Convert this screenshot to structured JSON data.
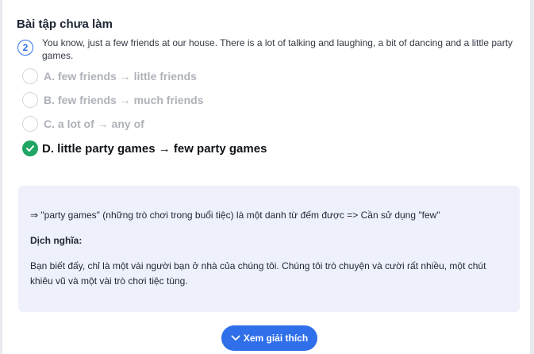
{
  "section": {
    "title": "Bài tập chưa làm"
  },
  "question": {
    "number": "2",
    "text": "You know, just a few friends at our house. There is a lot of talking and laughing, a bit of dancing and a little party games."
  },
  "options": [
    {
      "label": "A. few friends → little friends",
      "state": "unselected"
    },
    {
      "label": "B. few friends → much friends",
      "state": "unselected"
    },
    {
      "label": "C. a lot of → any of",
      "state": "unselected"
    },
    {
      "label": "D. little party games → few party games",
      "state": "correct"
    }
  ],
  "explanation": {
    "rule": "⇒ \"party games\" (những trò chơi trong buổi tiệc) là một danh từ đếm được => Cần sử dụng \"few\"",
    "translation_heading": "Dịch nghĩa:",
    "translation": "Bạn biết đấy, chỉ là một vài người bạn ở nhà của chúng tôi. Chúng tôi trò chuyện và cười rất nhiều, một chút khiêu vũ và một vài trò chơi tiệc tùng."
  },
  "button": {
    "label": "Xem giải thích",
    "icon": "chevron-down-icon"
  },
  "colors": {
    "accent": "#2f6fea",
    "correct": "#1fa564",
    "explain_bg": "#eef1fb"
  }
}
